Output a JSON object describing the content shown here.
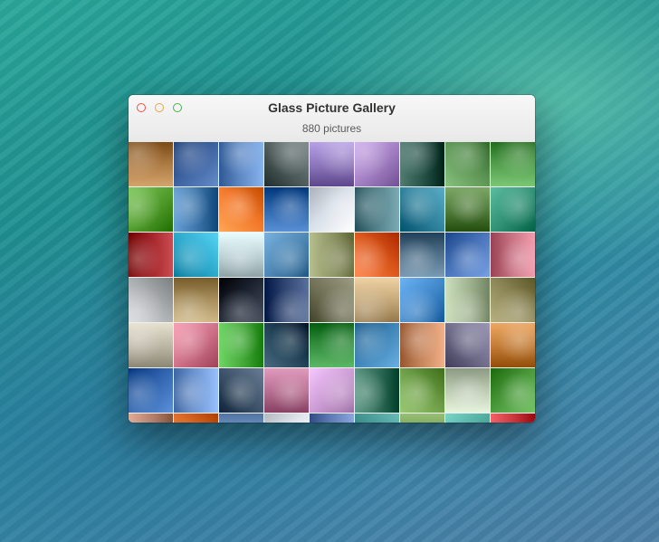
{
  "window": {
    "title": "Glass Picture Gallery",
    "subtitle": "880 pictures",
    "controls": [
      "close-icon",
      "minimize-icon",
      "zoom-icon"
    ]
  },
  "colors": {
    "close": "#f04f4a",
    "minimize": "#e6a53a",
    "zoom": "#48b14a"
  },
  "gallery": {
    "thumbnails": [
      [
        "#a8763f",
        "#3a5f9d",
        "#5b86c2",
        "#4c5a59",
        "#8a73b8",
        "#a07cc0",
        "#244f45",
        "#5a9352",
        "#4e9a49"
      ],
      [
        "#4f9a2b",
        "#3b73a8",
        "#f2782a",
        "#2c63a8",
        "#d8dfe8",
        "#4f7d86",
        "#2e7f9a",
        "#4f7a3a",
        "#2e8f73"
      ],
      [
        "#9e1f24",
        "#2aa6c9",
        "#bcd0d4",
        "#4c85b2",
        "#8a9160",
        "#d9551a",
        "#4d6d86",
        "#4873b8",
        "#c56f80"
      ],
      [
        "#a9acaf",
        "#a38a58",
        "#1b2230",
        "#2e4470",
        "#6f7056",
        "#c2a577",
        "#3f86c9",
        "#9fb28f",
        "#8a8454"
      ],
      [
        "#b9b3a2",
        "#cc6f86",
        "#42a838",
        "#1d3d52",
        "#2f8a3a",
        "#3d82b5",
        "#c4835b",
        "#6d6b88",
        "#c07a35"
      ],
      [
        "#2f63ad",
        "#6b93cf",
        "#3b5066",
        "#b46d8e",
        "#c99ad1",
        "#2e6b57",
        "#6b9c45",
        "#b9c7b0",
        "#479638"
      ],
      [
        "#b47f6a",
        "#dc6a28",
        "#7ea0cf",
        "#e1e5ec",
        "#5e79b1",
        "#3c8f8b",
        "#6b9348",
        "#4da89c",
        "#c7343a"
      ]
    ]
  }
}
